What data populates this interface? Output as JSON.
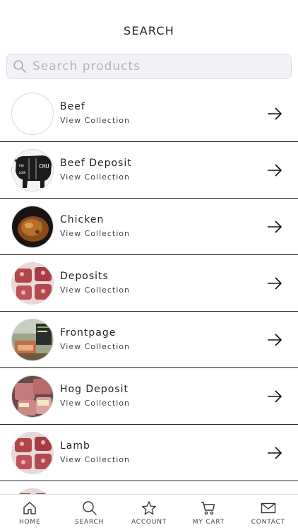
{
  "header": {
    "title": "SEARCH"
  },
  "search": {
    "placeholder": "Search products",
    "value": ""
  },
  "collections": [
    {
      "title": "Beef",
      "subtitle": "View Collection",
      "image": "blank"
    },
    {
      "title": "Beef Deposit",
      "subtitle": "View Collection",
      "image": "chuck-chalkboard"
    },
    {
      "title": "Chicken",
      "subtitle": "View Collection",
      "image": "roast-chicken"
    },
    {
      "title": "Deposits",
      "subtitle": "View Collection",
      "image": "raw-meat"
    },
    {
      "title": "Frontpage",
      "subtitle": "View Collection",
      "image": "market-stand"
    },
    {
      "title": "Hog Deposit",
      "subtitle": "View Collection",
      "image": "pork-packages"
    },
    {
      "title": "Lamb",
      "subtitle": "View Collection",
      "image": "raw-meat"
    }
  ],
  "tabbar": [
    {
      "label": "HOME",
      "icon": "home-icon"
    },
    {
      "label": "SEARCH",
      "icon": "search-icon"
    },
    {
      "label": "ACCOUNT",
      "icon": "star-icon"
    },
    {
      "label": "MY CART",
      "icon": "cart-icon"
    },
    {
      "label": "CONTACT",
      "icon": "mail-icon"
    }
  ]
}
